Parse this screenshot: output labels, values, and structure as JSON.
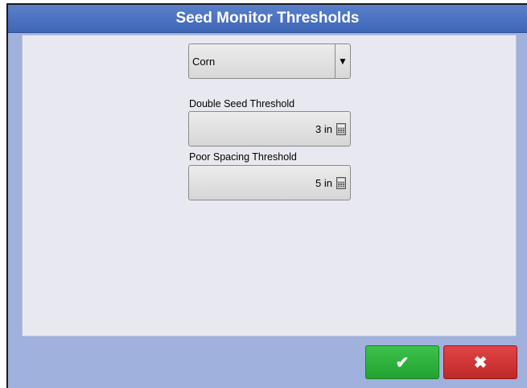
{
  "dialog": {
    "title": "Seed Monitor Thresholds"
  },
  "crop_select": {
    "value": "Corn",
    "arrow": "▼"
  },
  "double_seed": {
    "label": "Double Seed Threshold",
    "value": "3 in"
  },
  "poor_spacing": {
    "label": "Poor Spacing Threshold",
    "value": "5 in"
  },
  "buttons": {
    "ok_icon": "✔",
    "cancel_icon": "✖"
  },
  "colors": {
    "title_bar": "#4a70be",
    "ok": "#2db43c",
    "cancel": "#d13434",
    "frame_bg": "#9fb1dc"
  }
}
